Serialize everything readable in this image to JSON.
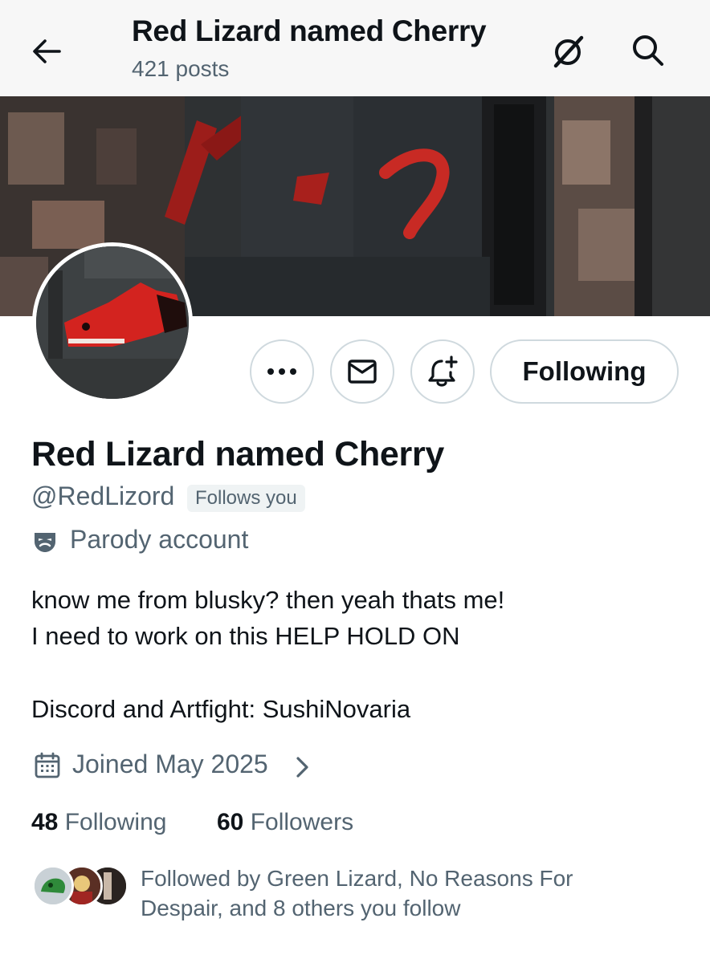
{
  "header": {
    "title": "Red Lizard named Cherry",
    "post_count": "421 posts",
    "icons": [
      "back-arrow-icon",
      "grok-icon",
      "search-icon"
    ]
  },
  "actions": {
    "more_icon": "more-icon",
    "message_icon": "envelope-icon",
    "notification_icon": "bell-plus-icon",
    "following_label": "Following"
  },
  "profile": {
    "display_name": "Red Lizard named Cherry",
    "handle": "@RedLizord",
    "follows_you": "Follows you",
    "parody_label": "Parody account",
    "bio_lines": [
      "know me from blusky? then yeah thats me!",
      "I need to work on this HELP HOLD ON",
      "Discord and Artfight: SushiNovaria"
    ],
    "joined": "Joined May 2025"
  },
  "stats": {
    "following_count": "48",
    "following_label": "Following",
    "followers_count": "60",
    "followers_label": "Followers"
  },
  "followed_by": {
    "text": "Followed by Green Lizard, No Reasons For Despair, and 8 others you follow"
  },
  "colors": {
    "text_primary": "#0f1419",
    "text_secondary": "#536471",
    "border": "#cfd9de",
    "accent_red": "#d3231f"
  }
}
